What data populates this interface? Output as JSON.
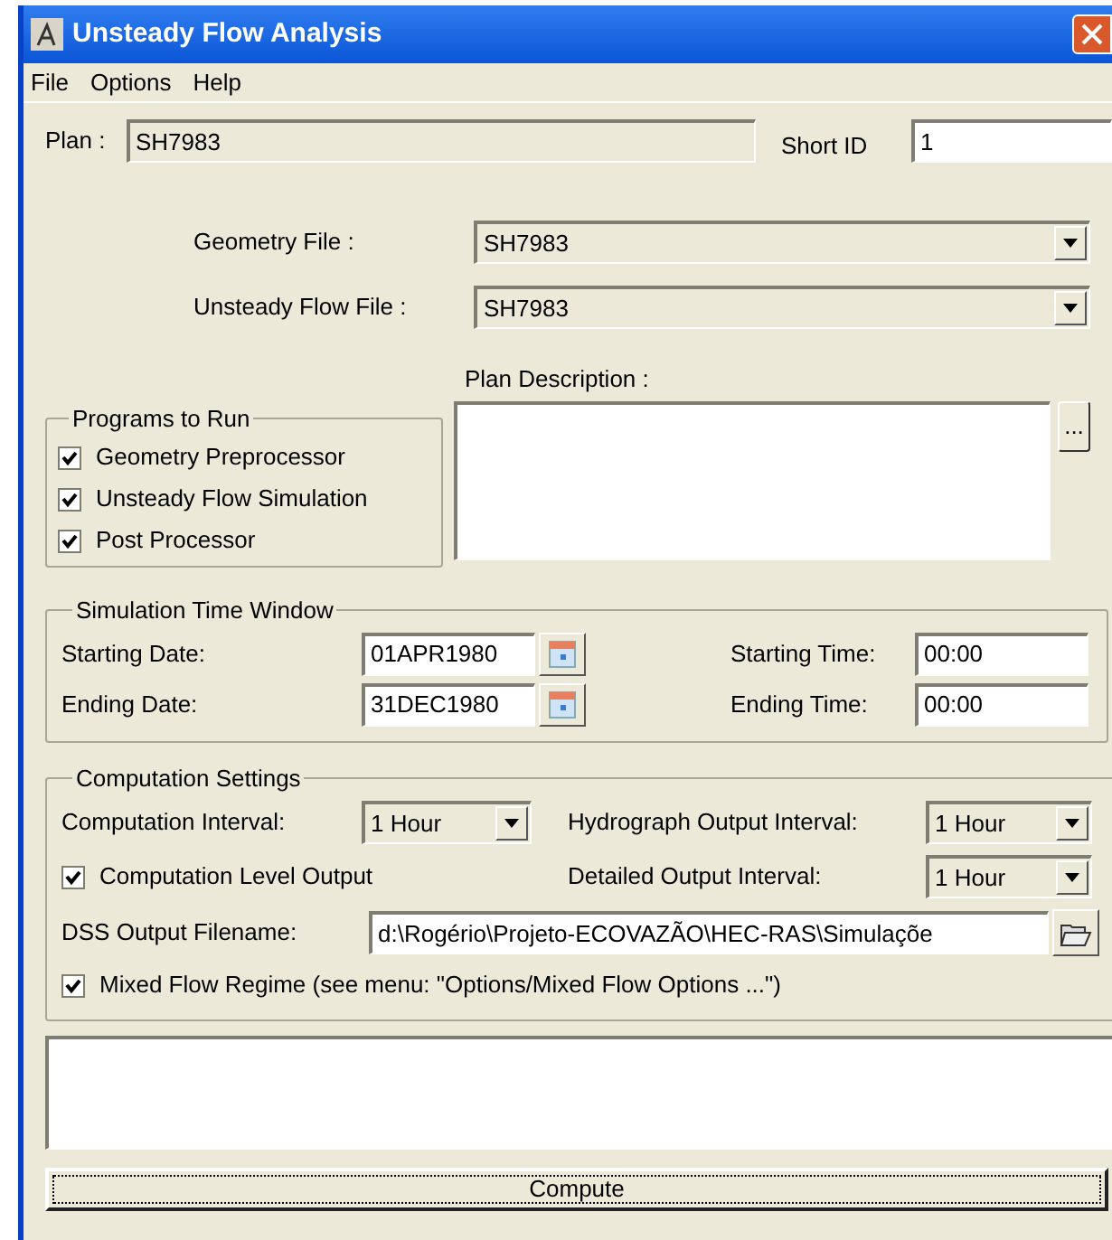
{
  "window": {
    "title": "Unsteady Flow Analysis"
  },
  "menu": [
    "File",
    "Options",
    "Help"
  ],
  "plan": {
    "label": "Plan :",
    "value": "SH7983",
    "short_id_label": "Short ID",
    "short_id": "1"
  },
  "geometry_file": {
    "label": "Geometry File :",
    "value": "SH7983"
  },
  "unsteady_flow_file": {
    "label": "Unsteady Flow File :",
    "value": "SH7983"
  },
  "programs_to_run": {
    "title": "Programs to Run",
    "items": [
      {
        "label": "Geometry Preprocessor",
        "checked": true
      },
      {
        "label": "Unsteady Flow Simulation",
        "checked": true
      },
      {
        "label": "Post Processor",
        "checked": true
      }
    ]
  },
  "plan_description": {
    "label": "Plan Description :",
    "button": "..."
  },
  "simulation_time_window": {
    "title": "Simulation Time Window",
    "starting_date_label": "Starting Date:",
    "starting_date": "01APR1980",
    "ending_date_label": "Ending Date:",
    "ending_date": "31DEC1980",
    "starting_time_label": "Starting Time:",
    "starting_time": "00:00",
    "ending_time_label": "Ending Time:",
    "ending_time": "00:00"
  },
  "computation_settings": {
    "title": "Computation Settings",
    "computation_interval_label": "Computation Interval:",
    "computation_interval": "1 Hour",
    "hydrograph_output_interval_label": "Hydrograph Output Interval:",
    "hydrograph_output_interval": "1 Hour",
    "computation_level_output": {
      "label": "Computation Level Output",
      "checked": true
    },
    "detailed_output_interval_label": "Detailed Output Interval:",
    "detailed_output_interval": "1 Hour",
    "dss_output_filename_label": "DSS Output Filename:",
    "dss_output_filename": "d:\\Rogério\\Projeto-ECOVAZÃO\\HEC-RAS\\Simulaçõe",
    "mixed_flow_regime": {
      "label": "Mixed Flow Regime (see menu: \"Options/Mixed Flow Options ...\")",
      "checked": true
    }
  },
  "compute_button": "Compute"
}
